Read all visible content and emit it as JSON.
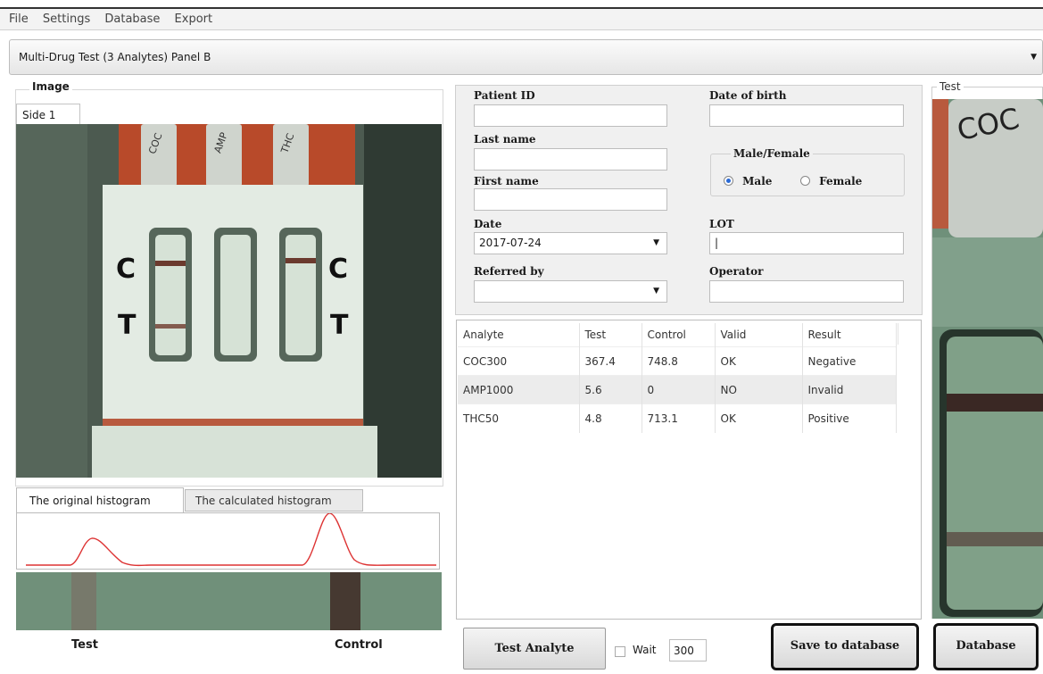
{
  "menu": [
    "File",
    "Settings",
    "Database",
    "Export"
  ],
  "panel_select": {
    "value": "Multi-Drug Test (3 Analytes) Panel B"
  },
  "image_group": {
    "title": "Image",
    "tab": "Side 1"
  },
  "device": {
    "labels": {
      "c_left": "C",
      "t_left": "T",
      "c_right": "C",
      "t_right": "T"
    },
    "cap_texts": [
      "COC",
      "AMP",
      "THC"
    ]
  },
  "histogram": {
    "tabs": [
      "The original histogram",
      "The calculated histogram"
    ],
    "strip_labels": {
      "test": "Test",
      "control": "Control"
    }
  },
  "form": {
    "patient_id": {
      "label": "Patient ID",
      "value": ""
    },
    "date_of_birth": {
      "label": "Date of birth",
      "value": ""
    },
    "last_name": {
      "label": "Last name",
      "value": ""
    },
    "first_name": {
      "label": "First name",
      "value": ""
    },
    "sex": {
      "title": "Male/Female",
      "options": [
        "Male",
        "Female"
      ],
      "selected": "Male"
    },
    "date": {
      "label": "Date",
      "value": "2017-07-24"
    },
    "lot": {
      "label": "LOT",
      "value": "|"
    },
    "referred_by": {
      "label": "Referred by",
      "value": ""
    },
    "operator": {
      "label": "Operator",
      "value": ""
    }
  },
  "results": {
    "columns": [
      "Analyte",
      "Test",
      "Control",
      "Valid",
      "Result"
    ],
    "rows": [
      [
        "COC300",
        "367.4",
        "748.8",
        "OK",
        "Negative"
      ],
      [
        "AMP1000",
        "5.6",
        "0",
        "NO",
        "Invalid"
      ],
      [
        "THC50",
        "4.8",
        "713.1",
        "OK",
        "Positive"
      ]
    ]
  },
  "controls": {
    "test_button": "Test Analyte",
    "wait_label": "Wait",
    "wait_value": "300",
    "save_button": "Save to  database",
    "database_button": "Database"
  },
  "test_view": {
    "title": "Test",
    "cap_text": "COC"
  }
}
